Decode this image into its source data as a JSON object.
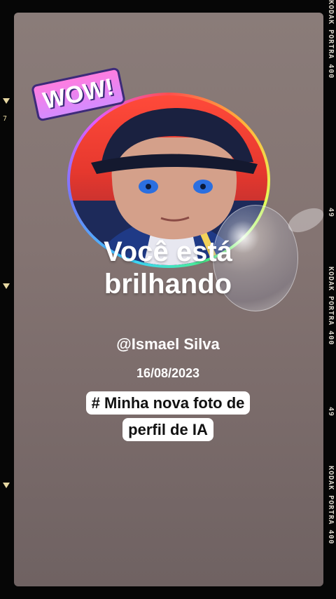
{
  "film": {
    "edge_label": "KODAK PORTRA 400",
    "frame_numbers": [
      "49",
      "49"
    ],
    "side_number": "7"
  },
  "sticker": {
    "text": "WOW!"
  },
  "profile": {
    "headline": "Você está brilhando",
    "handle": "@Ismael Silva",
    "date": "16/08/2023",
    "tag": "# Minha nova foto de perfil de IA"
  },
  "colors": {
    "background": "#7f7170",
    "text": "#ffffff",
    "tag_bg": "#ffffff"
  }
}
